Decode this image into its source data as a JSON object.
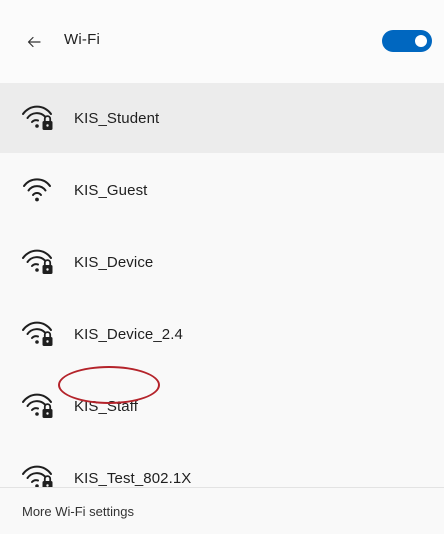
{
  "header": {
    "back_icon": "arrow-left-icon",
    "title": "Wi-Fi",
    "wifi_toggle_on": true,
    "accent_color": "#0067c0"
  },
  "networks": [
    {
      "ssid": "KIS_Student",
      "secured": true,
      "selected": true
    },
    {
      "ssid": "KIS_Guest",
      "secured": false,
      "selected": false
    },
    {
      "ssid": "KIS_Device",
      "secured": true,
      "selected": false
    },
    {
      "ssid": "KIS_Device_2.4",
      "secured": true,
      "selected": false
    },
    {
      "ssid": "KIS_Staff",
      "secured": true,
      "selected": false,
      "circled": true
    },
    {
      "ssid": "KIS_Test_802.1X",
      "secured": true,
      "selected": false
    }
  ],
  "annotation": {
    "color": "#b4232a"
  },
  "footer": {
    "settings_link": "More Wi-Fi settings"
  }
}
